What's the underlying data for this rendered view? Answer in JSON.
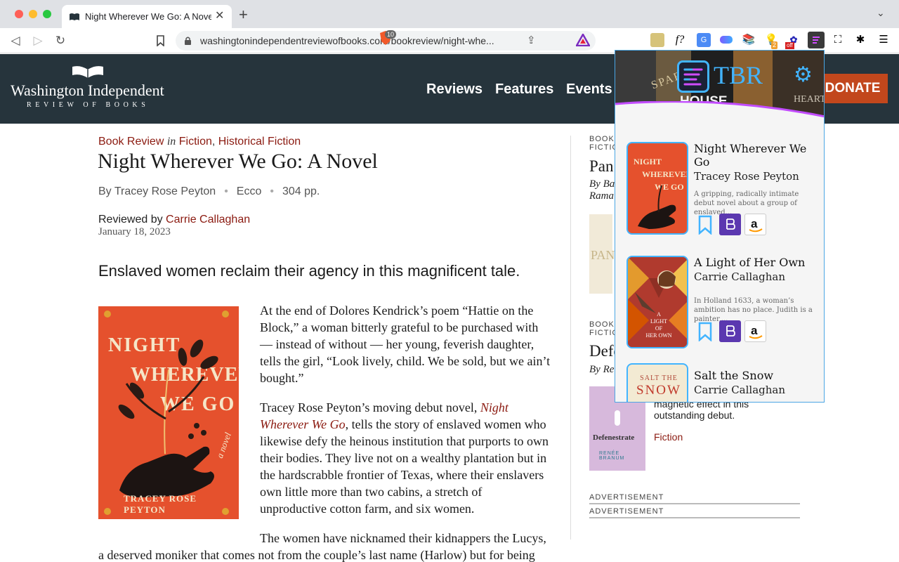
{
  "browser": {
    "tab_title": "Night Wherever We Go: A Novel",
    "new_tab": "+",
    "close": "✕",
    "url": "washingtonindependentreviewofbooks.com/bookreview/night-whe...",
    "brave_count": "10",
    "ext_badge_1": "2",
    "ext_badge_2": "off",
    "ext_f_label": "f?"
  },
  "site": {
    "logo_title": "Washington Independent",
    "logo_subtitle": "REVIEW OF BOOKS",
    "nav": [
      "Reviews",
      "Features",
      "Events"
    ],
    "donate": "DONATE"
  },
  "article": {
    "type": "Book Review",
    "in": "in",
    "genres": [
      "Fiction",
      "Historical Fiction"
    ],
    "genre_sep": ", ",
    "title": "Night Wherever We Go: A Novel",
    "byline": {
      "author": "By Tracey Rose Peyton",
      "publisher": "Ecco",
      "pages": "304 pp."
    },
    "reviewed_prefix": "Reviewed by ",
    "reviewer": "Carrie Callaghan",
    "date": "January 18, 2023",
    "lede": "Enslaved women reclaim their agency in this magnificent tale.",
    "cover": {
      "line1": "NIGHT",
      "line2": "WHEREVER",
      "line3": "WE GO",
      "tag": "a novel",
      "author": "TRACEY ROSE PEYTON"
    },
    "para1_lines": [
      "At the end of Dolores Kendrick’s poem “Hattie on the",
      "Block,” a woman bitterly grateful to be purchased with",
      "— instead of without — her young, feverish daughter,",
      "tells the girl, “Look lively, child. We be sold, but we ain’t",
      "bought.”"
    ],
    "para2_first": "Tracey Rose Peyton’s moving debut novel, ",
    "para2_title_a": "Night",
    "para2_title_b": "Wherever We Go",
    "para2_after": ", tells the story of enslaved women who",
    "para2_lines": [
      "likewise defy the heinous institution that purports to own",
      "their bodies. They live not on a wealthy plantation but in",
      "the hardscrabble frontier of Texas, where their enslavers",
      "own little more than two cabins, a stretch of",
      "unproductive cotton farm, and six women."
    ],
    "para3_lines": [
      "The women have nicknamed their kidnappers the Lucys,",
      "a deserved moniker that comes not from the couple’s last name (Harlow) but for being"
    ]
  },
  "sidebar": {
    "item1_label": [
      "BOOK",
      "FICTIO"
    ],
    "item1_title": "Pan",
    "item1_by": [
      "By Ba",
      "Rama"
    ],
    "item1_cover": "PAN",
    "item2_label": [
      "BOOK",
      "FICTIO"
    ],
    "item2_title": "Defe",
    "item2_by": "By Re",
    "item3_cover_title": "Defenestrate",
    "item3_cover_author": "RENÉE BRANUM",
    "item3_text": [
      "magnetic effect in this",
      "outstanding debut."
    ],
    "item3_genre": "Fiction",
    "ads": [
      "ADVERTISEMENT",
      "ADVERTISEMENT"
    ]
  },
  "tbr": {
    "name": "TBR",
    "books": [
      {
        "title": "Night Wherever We Go",
        "author": "Tracey Rose Peyton",
        "desc": "A gripping, radically intimate debut novel about a group of enslaved..."
      },
      {
        "title": "A Light of Her Own",
        "author": "Carrie Callaghan",
        "desc": "In Holland 1633, a woman’s ambition has no place. Judith is a painter,...",
        "cover_text": [
          "A",
          "LIGHT",
          "OF",
          "HER OWN"
        ]
      },
      {
        "title": "Salt the Snow",
        "author": "Carrie Callaghan",
        "cover_text": [
          "SALT THE",
          "SNOW"
        ]
      }
    ],
    "header_book_titles": [
      "SPARTA",
      "HOUSE",
      "HEART"
    ]
  },
  "colors": {
    "accent": "#42b4ff",
    "link": "#8b1a10",
    "header_bg": "#26343c",
    "donate": "#c2471c",
    "cover_orange": "#e5512d"
  }
}
